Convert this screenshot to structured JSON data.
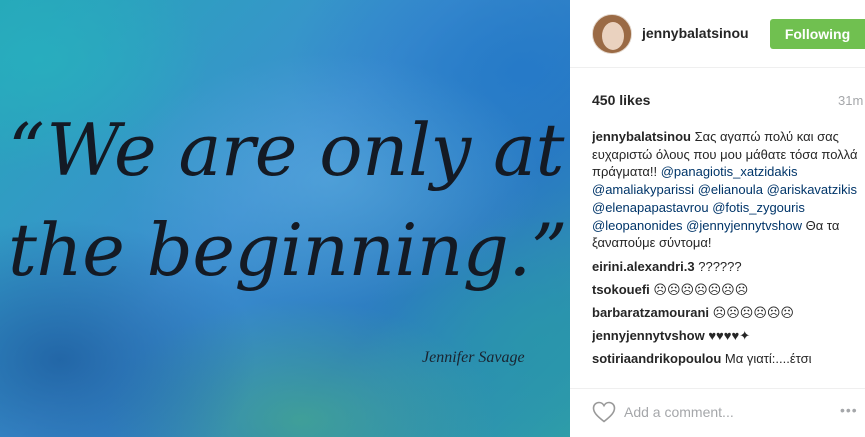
{
  "post": {
    "quote_line_1": "“We are only at",
    "quote_line_2": "the beginning.”",
    "quote_author": "Jennifer Savage"
  },
  "header": {
    "username": "jennybalatsinou",
    "follow_label": "Following"
  },
  "stats": {
    "likes": "450 likes",
    "time": "31m"
  },
  "caption": {
    "username": "jennybalatsinou",
    "text_1": "Σας αγαπώ πολύ και σας ευχαριστώ όλους που μου μάθατε τόσα πολλά πράγματα!!",
    "mentions": [
      "@panagiotis_xatzidakis",
      "@amaliakyparissi",
      "@elianoula",
      "@ariskavatzikis",
      "@elenapapastavrou",
      "@fotis_zygouris",
      "@leopanonides",
      "@jennyjennytvshow"
    ],
    "text_2": "Θα τα ξαναπούμε σύντομα!"
  },
  "comments": [
    {
      "username": "eirini.alexandri.3",
      "text": "??????"
    },
    {
      "username": "tsokouefi",
      "text": "☹☹☹☹☹☹☹"
    },
    {
      "username": "barbaratzamourani",
      "text": "☹☹☹☹☹☹"
    },
    {
      "username": "jennyjennytvshow",
      "text": "♥♥♥♥✦"
    },
    {
      "username": "sotiriaandrikopoulou",
      "text": "Μα γιατί:....έτσι"
    }
  ],
  "footer": {
    "comment_placeholder": "Add a comment...",
    "more_label": "•••",
    "heart_icon": "heart-outline"
  }
}
